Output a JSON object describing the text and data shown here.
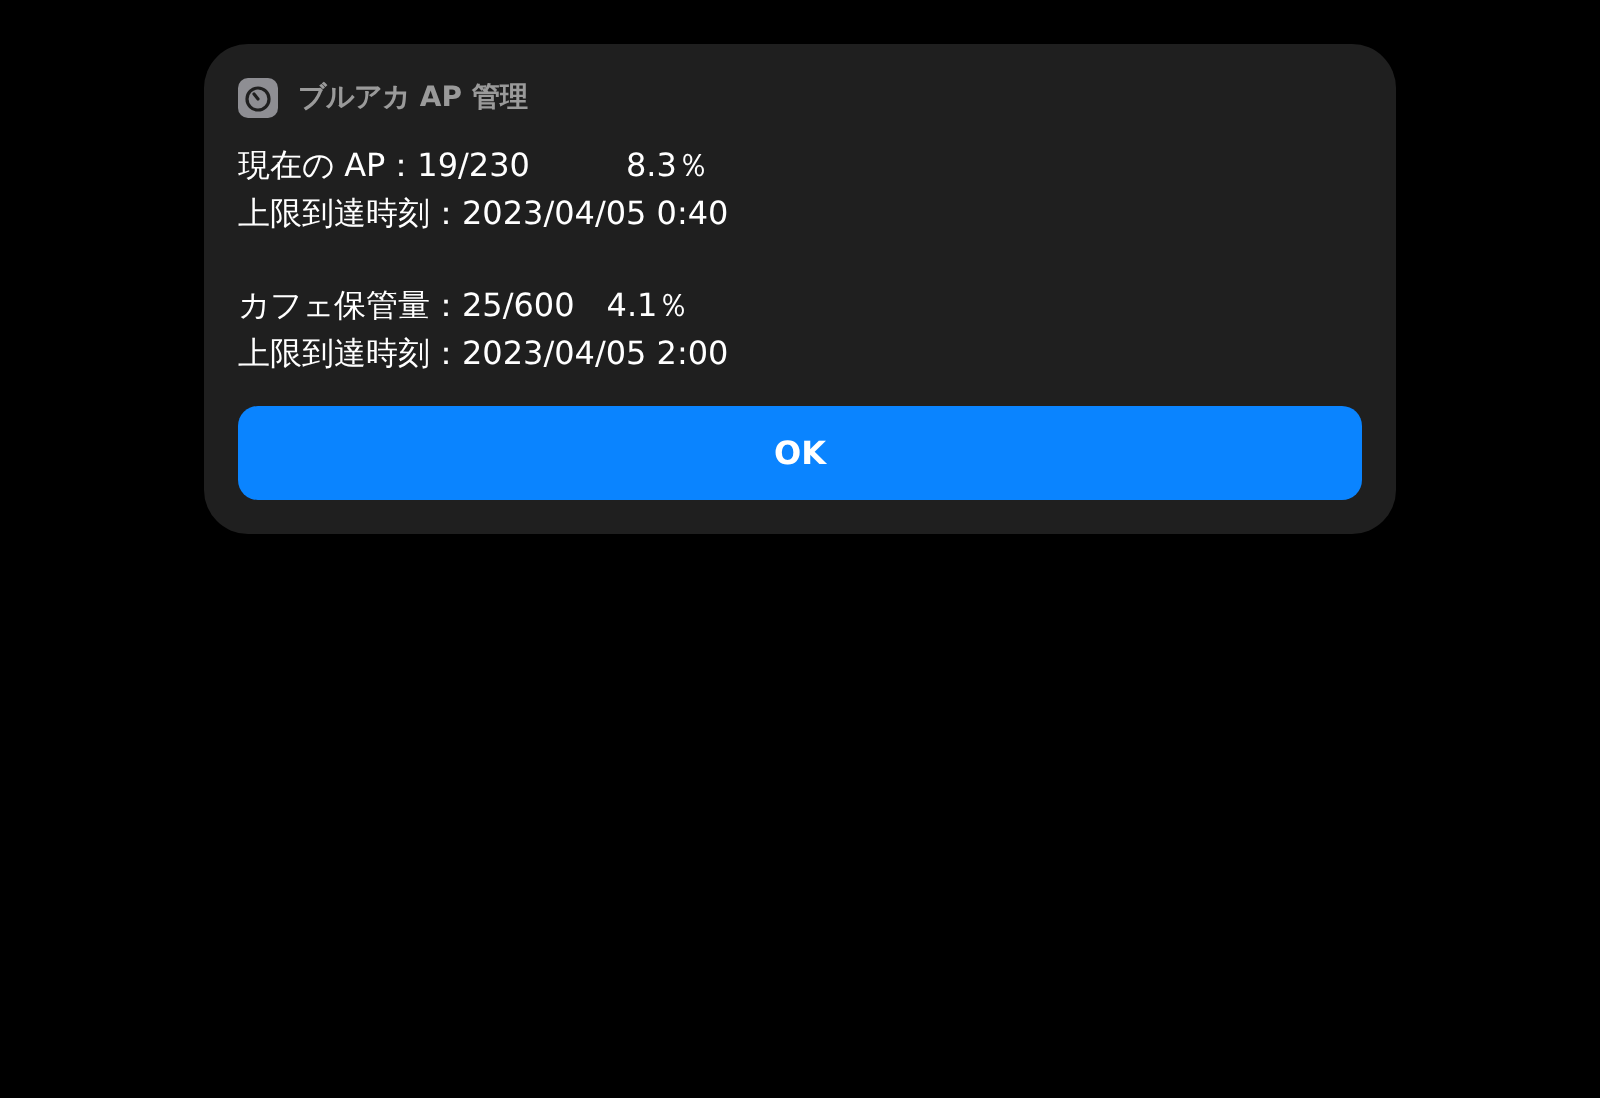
{
  "app": {
    "title": "ブルアカ AP 管理"
  },
  "message_groups": [
    {
      "lines": [
        "現在の AP：19/230　　　8.3％",
        "上限到達時刻：2023/04/05 0:40"
      ]
    },
    {
      "lines": [
        "カフェ保管量：25/600　4.1％",
        "上限到達時刻：2023/04/05 2:00"
      ]
    }
  ],
  "buttons": [
    "OK"
  ]
}
